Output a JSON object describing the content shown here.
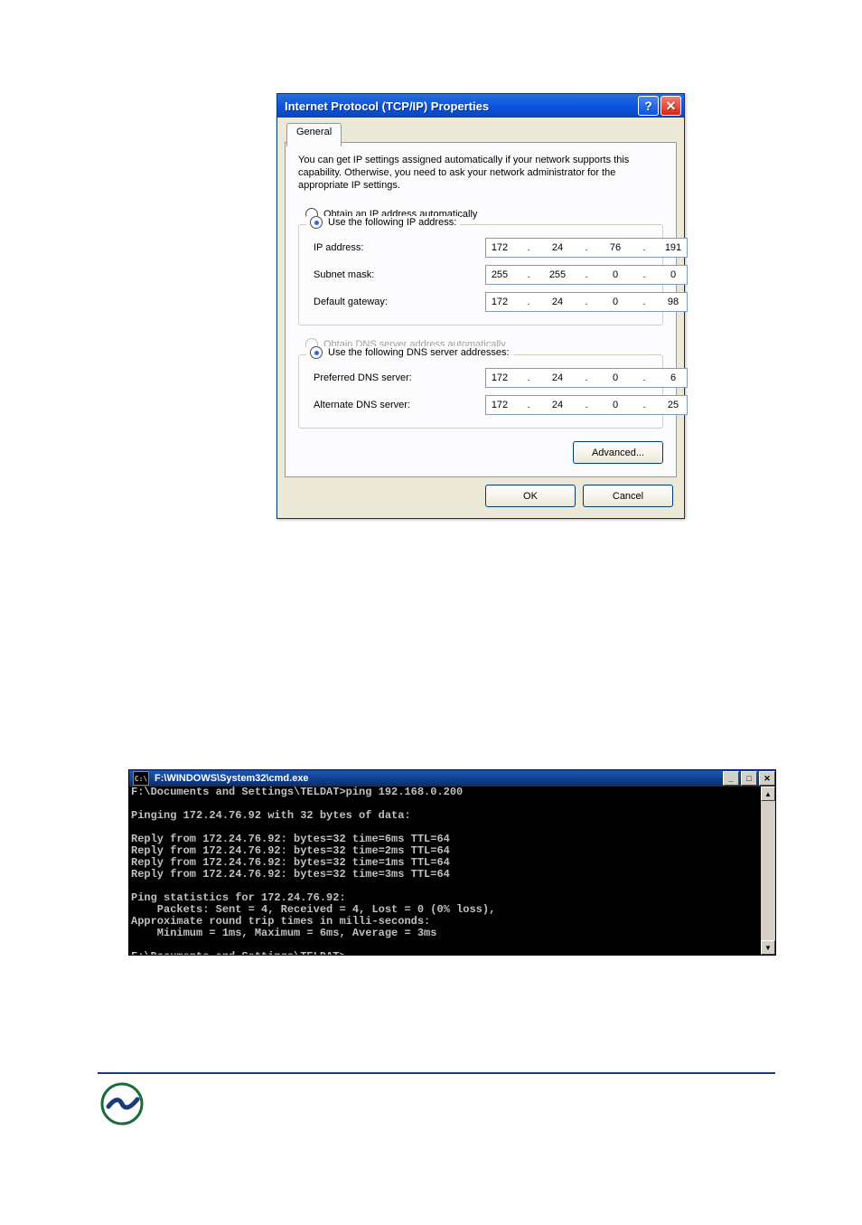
{
  "dialog": {
    "title": "Internet Protocol (TCP/IP) Properties",
    "tab": "General",
    "description": "You can get IP settings assigned automatically if your network supports this capability. Otherwise, you need to ask your network administrator for the appropriate IP settings.",
    "ip_section": {
      "radio_auto": "Obtain an IP address automatically",
      "radio_manual": "Use the following IP address:",
      "rows": {
        "ip_label": "IP address:",
        "ip_value": [
          "172",
          "24",
          "76",
          "191"
        ],
        "mask_label": "Subnet mask:",
        "mask_value": [
          "255",
          "255",
          "0",
          "0"
        ],
        "gw_label": "Default gateway:",
        "gw_value": [
          "172",
          "24",
          "0",
          "98"
        ]
      }
    },
    "dns_section": {
      "radio_auto": "Obtain DNS server address automatically",
      "radio_manual": "Use the following DNS server addresses:",
      "rows": {
        "pref_label": "Preferred DNS server:",
        "pref_value": [
          "172",
          "24",
          "0",
          "6"
        ],
        "alt_label": "Alternate DNS server:",
        "alt_value": [
          "172",
          "24",
          "0",
          "25"
        ]
      }
    },
    "advanced_btn": "Advanced...",
    "ok_btn": "OK",
    "cancel_btn": "Cancel"
  },
  "console": {
    "title": "F:\\WINDOWS\\System32\\cmd.exe",
    "lines": [
      "F:\\Documents and Settings\\TELDAT>ping 192.168.0.200",
      "",
      "Pinging 172.24.76.92 with 32 bytes of data:",
      "",
      "Reply from 172.24.76.92: bytes=32 time=6ms TTL=64",
      "Reply from 172.24.76.92: bytes=32 time=2ms TTL=64",
      "Reply from 172.24.76.92: bytes=32 time=1ms TTL=64",
      "Reply from 172.24.76.92: bytes=32 time=3ms TTL=64",
      "",
      "Ping statistics for 172.24.76.92:",
      "    Packets: Sent = 4, Received = 4, Lost = 0 (0% loss),",
      "Approximate round trip times in milli-seconds:",
      "    Minimum = 1ms, Maximum = 6ms, Average = 3ms",
      "",
      "F:\\Documents and Settings\\TELDAT>"
    ]
  }
}
